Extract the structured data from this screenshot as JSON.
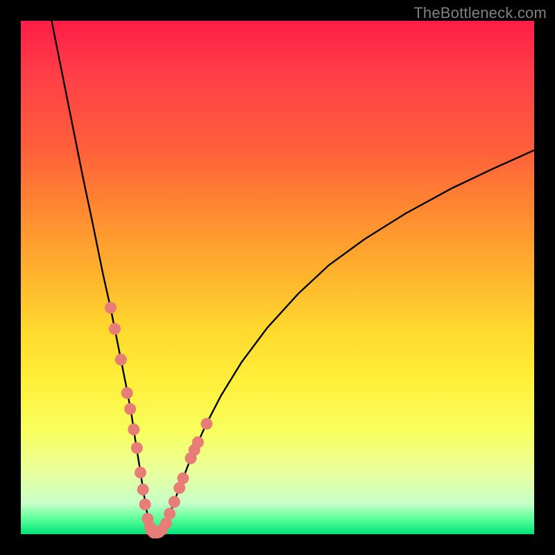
{
  "watermark": "TheBottleneck.com",
  "colors": {
    "background": "#000000",
    "curve": "#000000",
    "markers": "#e77d76",
    "axes_area_top": "#ff1c48",
    "axes_area_bottom": "#00e27a"
  },
  "chart_data": {
    "type": "line",
    "title": "",
    "xlabel": "",
    "ylabel": "",
    "xlim": [
      0,
      100
    ],
    "ylim": [
      0,
      100
    ],
    "legend": false,
    "grid": false,
    "series": [
      {
        "name": "bottleneck-curve",
        "x": [
          6,
          8,
          10,
          12,
          14,
          16,
          17.5,
          18.5,
          19.5,
          20.5,
          21.5,
          22.2,
          23,
          23.7,
          24.4,
          25,
          26,
          27.2,
          28.5,
          30.5,
          33,
          36,
          39,
          43,
          48,
          54,
          60,
          67,
          75,
          84,
          92,
          100
        ],
        "y": [
          100,
          90,
          80,
          70,
          60.5,
          50.7,
          44,
          39,
          34,
          29,
          23.7,
          19,
          14,
          9.5,
          5.2,
          2,
          0.3,
          0.3,
          2.5,
          8,
          14.5,
          21.2,
          27,
          33.5,
          40.2,
          46.8,
          52.4,
          57.5,
          62.5,
          67.4,
          71.2,
          74.8
        ]
      },
      {
        "name": "markers-left",
        "x": [
          17.5,
          18.3,
          19.5,
          20.7,
          21.3,
          22.0,
          22.6,
          23.3,
          23.8,
          24.2,
          24.7,
          25.2
        ],
        "y": [
          44.1,
          40.0,
          34.0,
          27.5,
          24.4,
          20.4,
          16.8,
          12.0,
          8.7,
          5.8,
          3.0,
          1.4
        ]
      },
      {
        "name": "markers-right",
        "x": [
          26.9,
          27.5,
          28.3,
          29.0,
          29.9,
          30.9,
          31.6,
          33.1,
          33.8,
          34.5,
          36.2
        ],
        "y": [
          0.4,
          0.9,
          2.1,
          4.0,
          6.3,
          9.0,
          10.9,
          14.8,
          16.4,
          17.9,
          21.5
        ]
      },
      {
        "name": "markers-bottom",
        "x": [
          25.4,
          25.9,
          26.5
        ],
        "y": [
          0.8,
          0.3,
          0.3
        ]
      }
    ]
  }
}
